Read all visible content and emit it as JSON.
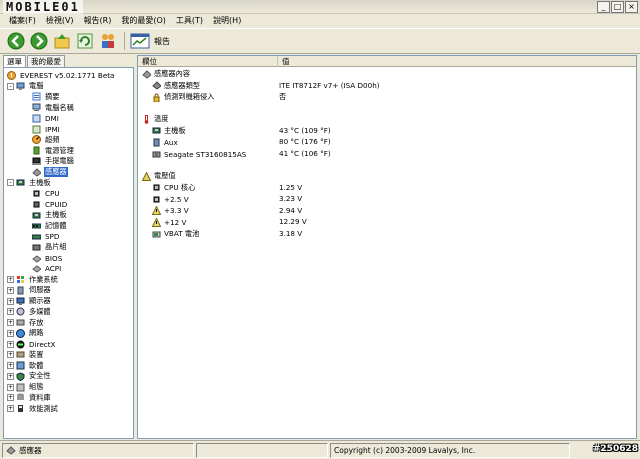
{
  "app": {
    "logo": "MOBILE01"
  },
  "menu": [
    "檔案(F)",
    "檢視(V)",
    "報告(R)",
    "我的最愛(O)",
    "工具(T)",
    "說明(H)"
  ],
  "toolbar": {
    "report_label": "報告"
  },
  "tabs": [
    "選單",
    "我的最愛"
  ],
  "tree": [
    {
      "label": "EVEREST v5.02.1771 Beta",
      "level": 0,
      "expander": "",
      "icon": "info-icon"
    },
    {
      "label": "電腦",
      "level": 0,
      "expander": "-",
      "icon": "computer-icon"
    },
    {
      "label": "摘要",
      "level": 2,
      "expander": "",
      "icon": "summary-icon"
    },
    {
      "label": "電腦名稱",
      "level": 2,
      "expander": "",
      "icon": "computer-name-icon"
    },
    {
      "label": "DMI",
      "level": 2,
      "expander": "",
      "icon": "dmi-icon"
    },
    {
      "label": "IPMI",
      "level": 2,
      "expander": "",
      "icon": "ipmi-icon"
    },
    {
      "label": "超頻",
      "level": 2,
      "expander": "",
      "icon": "overclock-icon"
    },
    {
      "label": "電源管理",
      "level": 2,
      "expander": "",
      "icon": "power-icon"
    },
    {
      "label": "手提電腦",
      "level": 2,
      "expander": "",
      "icon": "laptop-icon"
    },
    {
      "label": "感應器",
      "level": 2,
      "expander": "",
      "icon": "sensor-icon",
      "selected": true
    },
    {
      "label": "主機板",
      "level": 0,
      "expander": "-",
      "icon": "motherboard-icon"
    },
    {
      "label": "CPU",
      "level": 2,
      "expander": "",
      "icon": "cpu-icon"
    },
    {
      "label": "CPUID",
      "level": 2,
      "expander": "",
      "icon": "cpuid-icon"
    },
    {
      "label": "主機板",
      "level": 2,
      "expander": "",
      "icon": "motherboard-icon"
    },
    {
      "label": "記憶體",
      "level": 2,
      "expander": "",
      "icon": "memory-icon"
    },
    {
      "label": "SPD",
      "level": 2,
      "expander": "",
      "icon": "spd-icon"
    },
    {
      "label": "晶片組",
      "level": 2,
      "expander": "",
      "icon": "chipset-icon"
    },
    {
      "label": "BIOS",
      "level": 2,
      "expander": "",
      "icon": "bios-icon"
    },
    {
      "label": "ACPI",
      "level": 2,
      "expander": "",
      "icon": "acpi-icon"
    },
    {
      "label": "作業系統",
      "level": 0,
      "expander": "+",
      "icon": "os-icon"
    },
    {
      "label": "伺服器",
      "level": 0,
      "expander": "+",
      "icon": "server-icon"
    },
    {
      "label": "顯示器",
      "level": 0,
      "expander": "+",
      "icon": "display-icon"
    },
    {
      "label": "多媒體",
      "level": 0,
      "expander": "+",
      "icon": "multimedia-icon"
    },
    {
      "label": "存放",
      "level": 0,
      "expander": "+",
      "icon": "storage-icon"
    },
    {
      "label": "網路",
      "level": 0,
      "expander": "+",
      "icon": "network-icon"
    },
    {
      "label": "DirectX",
      "level": 0,
      "expander": "+",
      "icon": "directx-icon"
    },
    {
      "label": "裝置",
      "level": 0,
      "expander": "+",
      "icon": "devices-icon"
    },
    {
      "label": "軟體",
      "level": 0,
      "expander": "+",
      "icon": "software-icon"
    },
    {
      "label": "安全性",
      "level": 0,
      "expander": "+",
      "icon": "security-icon"
    },
    {
      "label": "組態",
      "level": 0,
      "expander": "+",
      "icon": "config-icon"
    },
    {
      "label": "資料庫",
      "level": 0,
      "expander": "+",
      "icon": "database-icon"
    },
    {
      "label": "效能測試",
      "level": 0,
      "expander": "+",
      "icon": "benchmark-icon"
    }
  ],
  "columns": {
    "field": "欄位",
    "value": "值"
  },
  "rows": [
    {
      "type": "group",
      "label": "感應器內容",
      "icon": "sensor-icon"
    },
    {
      "type": "item",
      "label": "感應器類型",
      "value": "ITE IT8712F v7+ (ISA D00h)",
      "icon": "sensor-chip-icon"
    },
    {
      "type": "item",
      "label": "偵測到機箱侵入",
      "value": "否",
      "icon": "chassis-lock-icon"
    },
    {
      "type": "blank"
    },
    {
      "type": "group",
      "label": "溫度",
      "icon": "thermometer-icon"
    },
    {
      "type": "item",
      "label": "主機板",
      "value": "43 °C  (109 °F)",
      "icon": "motherboard-icon"
    },
    {
      "type": "item",
      "label": "Aux",
      "value": "80 °C  (176 °F)",
      "icon": "aux-icon"
    },
    {
      "type": "item",
      "label": "Seagate ST3160815AS",
      "value": "41 °C  (106 °F)",
      "icon": "hdd-icon"
    },
    {
      "type": "blank"
    },
    {
      "type": "group",
      "label": "電壓值",
      "icon": "voltage-icon"
    },
    {
      "type": "item",
      "label": "CPU 核心",
      "value": "1.25 V",
      "icon": "cpu-icon"
    },
    {
      "type": "item",
      "label": "+2.5 V",
      "value": "3.23 V",
      "icon": "cpu-icon"
    },
    {
      "type": "item",
      "label": "+3.3 V",
      "value": "2.94 V",
      "icon": "warning-icon"
    },
    {
      "type": "item",
      "label": "+12 V",
      "value": "12.29 V",
      "icon": "warning-icon"
    },
    {
      "type": "item",
      "label": "VBAT 電池",
      "value": "3.18 V",
      "icon": "battery-icon"
    }
  ],
  "status": {
    "left": "感應器",
    "copyright": "Copyright (c) 2003-2009 Lavalys, Inc."
  },
  "watermark": "#250628",
  "colors": {
    "selection": "#316ac5",
    "chrome": "#ece9d8",
    "border": "#7f9db9"
  }
}
